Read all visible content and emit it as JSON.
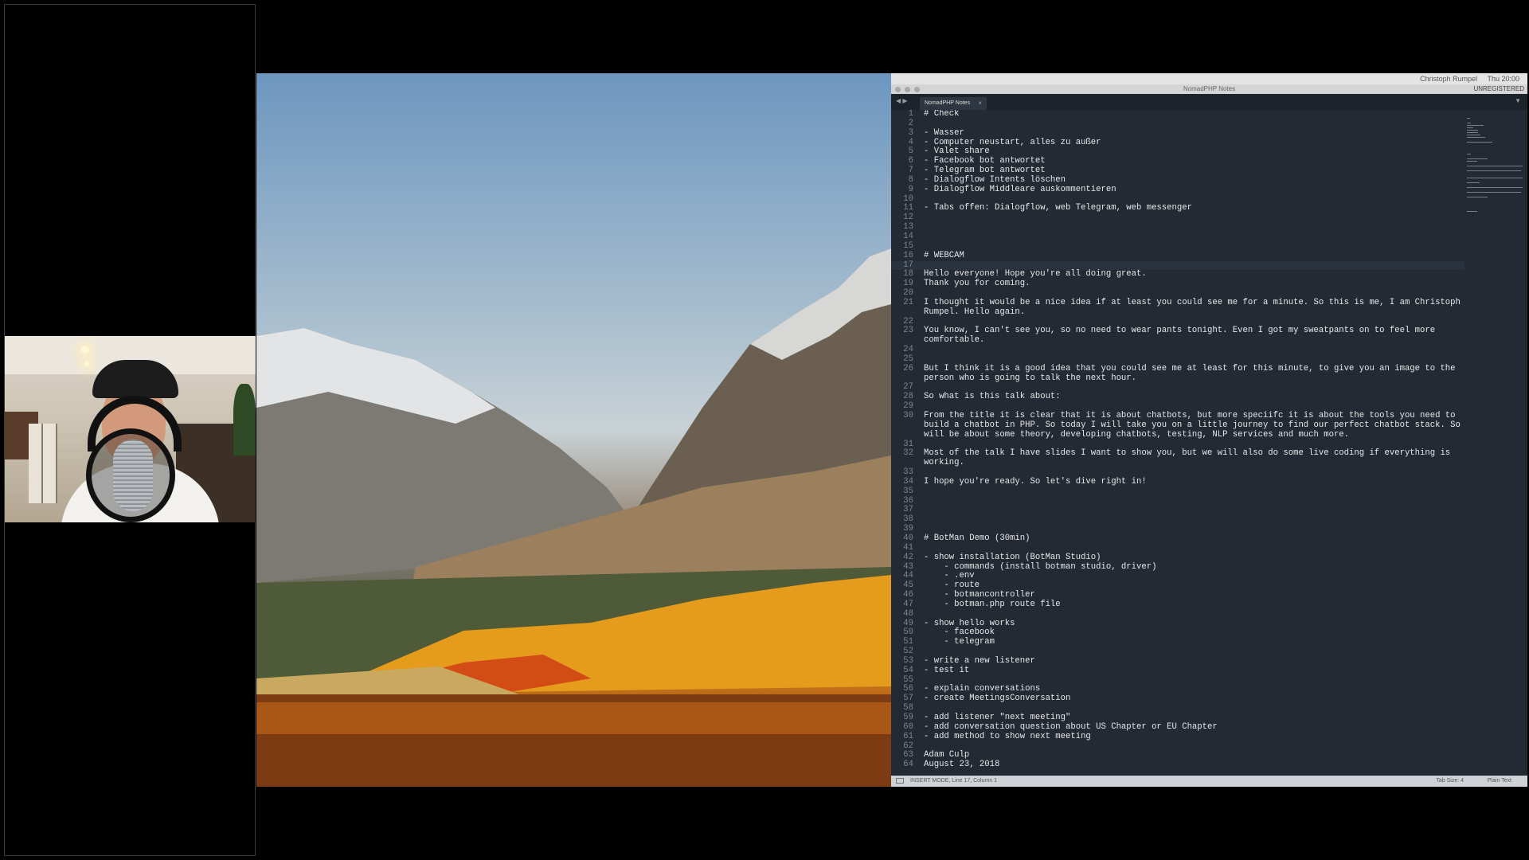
{
  "editor": {
    "window_title": "NomadPHP Notes",
    "unregistered": "UNREGISTERED",
    "menubar_user": "Christoph Rumpel",
    "menubar_time": "Thu 20:00",
    "tab_label": "NomadPHP Notes",
    "tab_close": "×",
    "status_left": "INSERT MODE, Line 17, Column 1",
    "status_tab_size": "Tab Size: 4",
    "status_syntax": "Plain Text",
    "active_line": 17,
    "lines": [
      "# Check",
      "",
      "- Wasser",
      "- Computer neustart, alles zu außer",
      "- Valet share",
      "- Facebook bot antwortet",
      "- Telegram bot antwortet",
      "- Dialogflow Intents löschen",
      "- Dialogflow Middleare auskommentieren",
      "",
      "- Tabs offen: Dialogflow, web Telegram, web messenger",
      "",
      "",
      "",
      "",
      "# WEBCAM",
      "",
      "Hello everyone! Hope you're all doing great.",
      "Thank you for coming.",
      "",
      "I thought it would be a nice idea if at least you could see me for a minute. So this is me, I am Christoph\nRumpel. Hello again.",
      "",
      "You know, I can't see you, so no need to wear pants tonight. Even I got my sweatpants on to feel more\ncomfortable.",
      "",
      "",
      "But I think it is a good idea that you could see me at least for this minute, to give you an image to the\nperson who is going to talk the next hour.",
      "",
      "So what is this talk about:",
      "",
      "From the title it is clear that it is about chatbots, but more speciifc it is about the tools you need to\nbuild a chatbot in PHP. So today I will take you on a little journey to find our perfect chatbot stack. So it\nwill be about some theory, developing chatbots, testing, NLP services and much more.",
      "",
      "Most of the talk I have slides I want to show you, but we will also do some live coding if everything is\nworking.",
      "",
      "I hope you're ready. So let's dive right in!",
      "",
      "",
      "",
      "",
      "",
      "# BotMan Demo (30min)",
      "",
      "- show installation (BotMan Studio)",
      "    - commands (install botman studio, driver)",
      "    - .env",
      "    - route",
      "    - botmancontroller",
      "    - botman.php route file",
      "",
      "- show hello works",
      "    - facebook",
      "    - telegram",
      "",
      "- write a new listener",
      "- test it",
      "",
      "- explain conversations",
      "- create MeetingsConversation",
      "",
      "- add listener \"next meeting\"",
      "- add conversation question about US Chapter or EU Chapter",
      "- add method to show next meeting",
      "",
      "Adam Culp",
      "August 23, 2018"
    ]
  }
}
